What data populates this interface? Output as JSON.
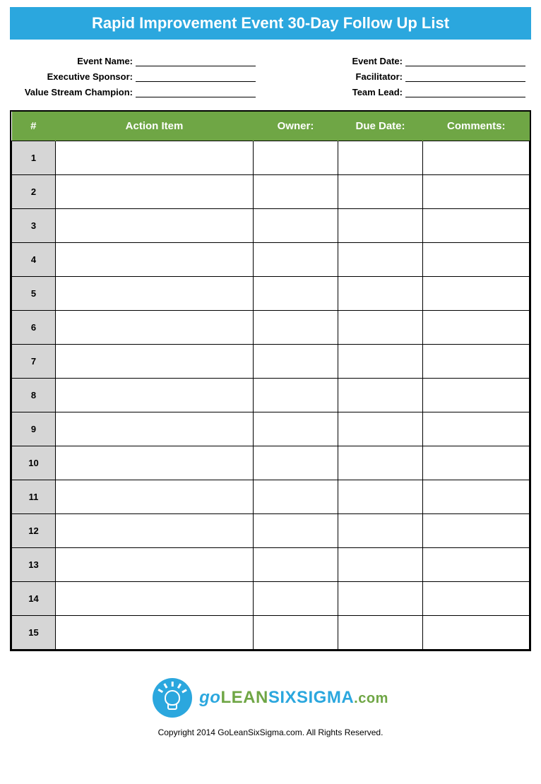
{
  "title": "Rapid Improvement Event 30-Day Follow Up List",
  "meta": {
    "left": [
      {
        "label": "Event Name:",
        "value": ""
      },
      {
        "label": "Executive Sponsor:",
        "value": ""
      },
      {
        "label": "Value Stream Champion:",
        "value": ""
      }
    ],
    "right": [
      {
        "label": "Event Date:",
        "value": ""
      },
      {
        "label": "Facilitator:",
        "value": ""
      },
      {
        "label": "Team Lead:",
        "value": ""
      }
    ]
  },
  "table": {
    "headers": [
      "#",
      "Action Item",
      "Owner:",
      "Due Date:",
      "Comments:"
    ],
    "rows": [
      {
        "num": "1",
        "action": "",
        "owner": "",
        "due": "",
        "comments": ""
      },
      {
        "num": "2",
        "action": "",
        "owner": "",
        "due": "",
        "comments": ""
      },
      {
        "num": "3",
        "action": "",
        "owner": "",
        "due": "",
        "comments": ""
      },
      {
        "num": "4",
        "action": "",
        "owner": "",
        "due": "",
        "comments": ""
      },
      {
        "num": "5",
        "action": "",
        "owner": "",
        "due": "",
        "comments": ""
      },
      {
        "num": "6",
        "action": "",
        "owner": "",
        "due": "",
        "comments": ""
      },
      {
        "num": "7",
        "action": "",
        "owner": "",
        "due": "",
        "comments": ""
      },
      {
        "num": "8",
        "action": "",
        "owner": "",
        "due": "",
        "comments": ""
      },
      {
        "num": "9",
        "action": "",
        "owner": "",
        "due": "",
        "comments": ""
      },
      {
        "num": "10",
        "action": "",
        "owner": "",
        "due": "",
        "comments": ""
      },
      {
        "num": "11",
        "action": "",
        "owner": "",
        "due": "",
        "comments": ""
      },
      {
        "num": "12",
        "action": "",
        "owner": "",
        "due": "",
        "comments": ""
      },
      {
        "num": "13",
        "action": "",
        "owner": "",
        "due": "",
        "comments": ""
      },
      {
        "num": "14",
        "action": "",
        "owner": "",
        "due": "",
        "comments": ""
      },
      {
        "num": "15",
        "action": "",
        "owner": "",
        "due": "",
        "comments": ""
      }
    ]
  },
  "logo": {
    "go": "go",
    "lean": "LEAN",
    "six": "SIXSIGMA",
    "com": ".com"
  },
  "copyright": "Copyright 2014 GoLeanSixSigma.com. All Rights Reserved."
}
